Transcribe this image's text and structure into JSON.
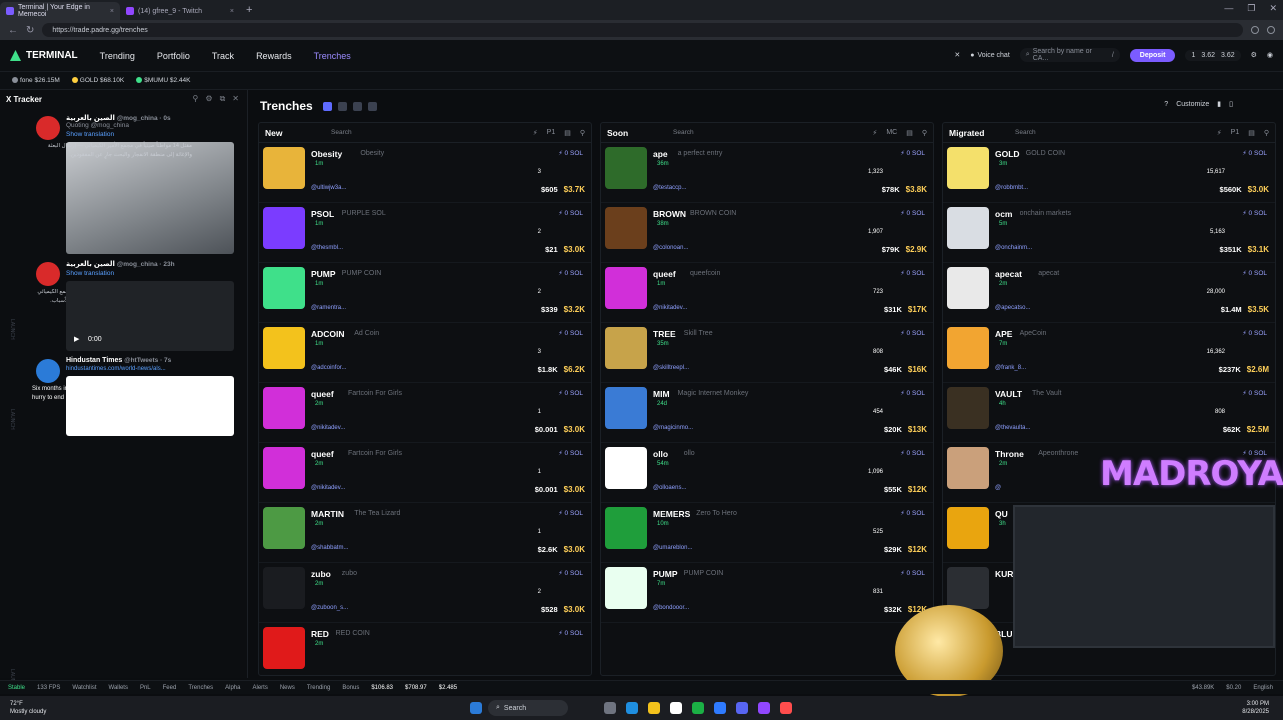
{
  "browser": {
    "tabs": [
      {
        "title": "Terminal | Your Edge in Memecoi"
      },
      {
        "title": "(14) gfree_9 - Twitch"
      }
    ],
    "url": "https://trade.padre.gg/trenches"
  },
  "header": {
    "brand": "TERMINAL",
    "nav": [
      "Trending",
      "Portfolio",
      "Track",
      "Rewards",
      "Trenches"
    ],
    "active_nav": "Trenches",
    "voice": "Voice chat",
    "search_placeholder": "Search by name or CA...",
    "search_key": "/",
    "deposit": "Deposit",
    "wallet": [
      "1",
      "3.62",
      "3.62"
    ]
  },
  "strip": [
    {
      "label": "fone",
      "value": "$26.15M",
      "color": "#8a8f99"
    },
    {
      "label": "GOLD",
      "value": "$68.10K",
      "color": "#ffcf3f"
    },
    {
      "label": "$MUMU",
      "value": "$2.44K",
      "color": "#3fe08a"
    }
  ],
  "tracker": {
    "title": "X Tracker",
    "tweets": [
      {
        "name": "الصين بالعربية",
        "handle": "@mog_china · 0s",
        "quoting": "Quoting @mog_china",
        "text": "مقتل 14 مواطناً صينياً في مجمع الأمير الكيميائي — إرسال البعثة والإغاثة إلى منطقة الانفجار والبحث جارٍ عن المفقودين.",
        "translate": "Show translation"
      },
      {
        "name": "الصين بالعربية",
        "handle": "@mog_china · 23h",
        "text": "كارثة في مجمع كيميائي بالصين — الحريق اندلع في المجمع الكيميائي وسط الدخان الكثيف، والتحقيقات الأولية جارية لمعرفة الأسباب.",
        "translate": "Show translation",
        "video_time": "0:00"
      },
      {
        "name": "Hindustan Times",
        "handle": "@htTweets · 7s",
        "text": "Six months into Iran war, Donald Trump says he's in no hurry to end it",
        "link": "hindustantimes.com/world-news/als...",
        "promo": "For News on the go, Download HT app"
      }
    ],
    "rail": [
      "LAUNCH",
      "LAUNCH",
      "LAUNCH"
    ]
  },
  "main": {
    "title": "Trenches",
    "customize": "Customize",
    "columns": [
      {
        "title": "New",
        "search": "Search",
        "tools": "P1",
        "rows": [
          {
            "sym": "Obesity",
            "name": "Obesity",
            "age": "1m",
            "addr": "@ultiwjw3a...",
            "tx": "3",
            "vol": "$605",
            "mc": "$3.7K",
            "thumb": "#e8b43a"
          },
          {
            "sym": "PSOL",
            "name": "PURPLE SOL",
            "age": "1m",
            "addr": "@thesmbl...",
            "tx": "2",
            "vol": "$21",
            "mc": "$3.0K",
            "thumb": "#7b3cff"
          },
          {
            "sym": "PUMP",
            "name": "PUMP COIN",
            "age": "1m",
            "addr": "@ramentra...",
            "tx": "2",
            "vol": "$339",
            "mc": "$3.2K",
            "thumb": "#3fe08a"
          },
          {
            "sym": "ADCOIN",
            "name": "Ad Coin",
            "age": "1m",
            "addr": "@adcoinfor...",
            "tx": "3",
            "vol": "$1.8K",
            "mc": "$6.2K",
            "thumb": "#f3c21c"
          },
          {
            "sym": "queef",
            "name": "Fartcoin For Girls",
            "age": "2m",
            "addr": "@nikitadev...",
            "tx": "1",
            "vol": "$0.001",
            "mc": "$3.0K",
            "thumb": "#d12fd9"
          },
          {
            "sym": "queef",
            "name": "Fartcoin For Girls",
            "age": "2m",
            "addr": "@nikitadev...",
            "tx": "1",
            "vol": "$0.001",
            "mc": "$3.0K",
            "thumb": "#d12fd9"
          },
          {
            "sym": "MARTIN",
            "name": "The Tea Lizard",
            "age": "2m",
            "addr": "@shabbatm...",
            "tx": "1",
            "vol": "$2.6K",
            "mc": "$3.0K",
            "thumb": "#4d9a44"
          },
          {
            "sym": "zubo",
            "name": "zubo",
            "age": "2m",
            "addr": "@zuboon_s...",
            "tx": "2",
            "vol": "$528",
            "mc": "$3.0K",
            "thumb": "#1a1c20"
          },
          {
            "sym": "RED",
            "name": "RED COIN",
            "age": "2m",
            "addr": "",
            "tx": "",
            "vol": "",
            "mc": "",
            "thumb": "#e01a1a"
          }
        ]
      },
      {
        "title": "Soon",
        "search": "Search",
        "tools": "MC",
        "rows": [
          {
            "sym": "ape",
            "name": "a perfect entry",
            "age": "36m",
            "addr": "@testaccp...",
            "tx": "1,323",
            "vol": "$78K",
            "mc": "$3.8K",
            "thumb": "#2e6b2a"
          },
          {
            "sym": "BROWN",
            "name": "BROWN COIN",
            "age": "38m",
            "addr": "@colonoan...",
            "tx": "1,907",
            "vol": "$79K",
            "mc": "$2.9K",
            "thumb": "#6b3f1c"
          },
          {
            "sym": "queef",
            "name": "queefcoin",
            "age": "1m",
            "addr": "@nikitadev...",
            "tx": "723",
            "vol": "$31K",
            "mc": "$17K",
            "thumb": "#d12fd9"
          },
          {
            "sym": "TREE",
            "name": "Skill Tree",
            "age": "35m",
            "addr": "@skilltreepl...",
            "tx": "808",
            "vol": "$46K",
            "mc": "$16K",
            "thumb": "#c7a34a"
          },
          {
            "sym": "MIM",
            "name": "Magic Internet Monkey",
            "age": "24d",
            "addr": "@magicinmo...",
            "tx": "454",
            "vol": "$20K",
            "mc": "$13K",
            "thumb": "#3a7bd5"
          },
          {
            "sym": "ollo",
            "name": "ollo",
            "age": "54m",
            "addr": "@olloaens...",
            "tx": "1,096",
            "vol": "$55K",
            "mc": "$12K",
            "thumb": "#ffffff"
          },
          {
            "sym": "MEMERS",
            "name": "Zero To Hero",
            "age": "10m",
            "addr": "@umareblon...",
            "tx": "525",
            "vol": "$29K",
            "mc": "$12K",
            "thumb": "#1f9e3b"
          },
          {
            "sym": "PUMP",
            "name": "PUMP COIN",
            "age": "7m",
            "addr": "@bondooor...",
            "tx": "831",
            "vol": "$32K",
            "mc": "$12K",
            "thumb": "#e9fff0"
          }
        ]
      },
      {
        "title": "Migrated",
        "search": "Search",
        "tools": "P1",
        "rows": [
          {
            "sym": "GOLD",
            "name": "GOLD COIN",
            "age": "3m",
            "addr": "@robbmbt...",
            "tx": "15,617",
            "vol": "$560K",
            "mc": "$3.0K",
            "thumb": "#f4e06b"
          },
          {
            "sym": "ocm",
            "name": "onchain markets",
            "age": "5m",
            "addr": "@onchainm...",
            "tx": "5,163",
            "vol": "$351K",
            "mc": "$3.1K",
            "thumb": "#d9dde3"
          },
          {
            "sym": "apecat",
            "name": "apecat",
            "age": "2m",
            "addr": "@apecatso...",
            "tx": "28,000",
            "vol": "$1.4M",
            "mc": "$3.5K",
            "thumb": "#e9e9e9"
          },
          {
            "sym": "APE",
            "name": "ApeCoin",
            "age": "7m",
            "addr": "@frank_8...",
            "tx": "16,362",
            "vol": "$237K",
            "mc": "$2.6M",
            "thumb": "#f2a531"
          },
          {
            "sym": "VAULT",
            "name": "The Vault",
            "age": "4h",
            "addr": "@thevaulta...",
            "tx": "808",
            "vol": "$62K",
            "mc": "$2.5M",
            "thumb": "#3a3022"
          },
          {
            "sym": "Throne",
            "name": "Apeonthrone",
            "age": "2m",
            "addr": "@",
            "tx": "",
            "vol": "",
            "mc": "",
            "thumb": "#caa07b"
          },
          {
            "sym": "QU",
            "name": "",
            "age": "3h",
            "addr": "",
            "tx": "",
            "vol": "",
            "mc": "",
            "thumb": "#e9a50f"
          },
          {
            "sym": "KUR",
            "name": "",
            "age": "",
            "addr": "",
            "tx": "",
            "vol": "",
            "mc": "",
            "thumb": "#2b2e33"
          },
          {
            "sym": "BLUE",
            "name": "",
            "age": "",
            "addr": "",
            "tx": "",
            "vol": "",
            "mc": "",
            "thumb": "#1b4dd6"
          }
        ]
      }
    ]
  },
  "overlay": {
    "streamer_name": "MADROYALS"
  },
  "statusbar": {
    "items": [
      "Stable",
      "133 FPS",
      "Watchlist",
      "Wallets",
      "PnL",
      "Feed",
      "Trenches",
      "Alpha",
      "Alerts",
      "News",
      "Trending",
      "Bonus"
    ],
    "prices": [
      "$106.83",
      "$708.97",
      "$2.485"
    ],
    "right": [
      "$43.89K",
      "$0.20",
      "English"
    ]
  },
  "taskbar": {
    "temp": "72°F",
    "weather": "Mostly cloudy",
    "search": "Search",
    "time": "3:00 PM",
    "date": "8/28/2025"
  }
}
